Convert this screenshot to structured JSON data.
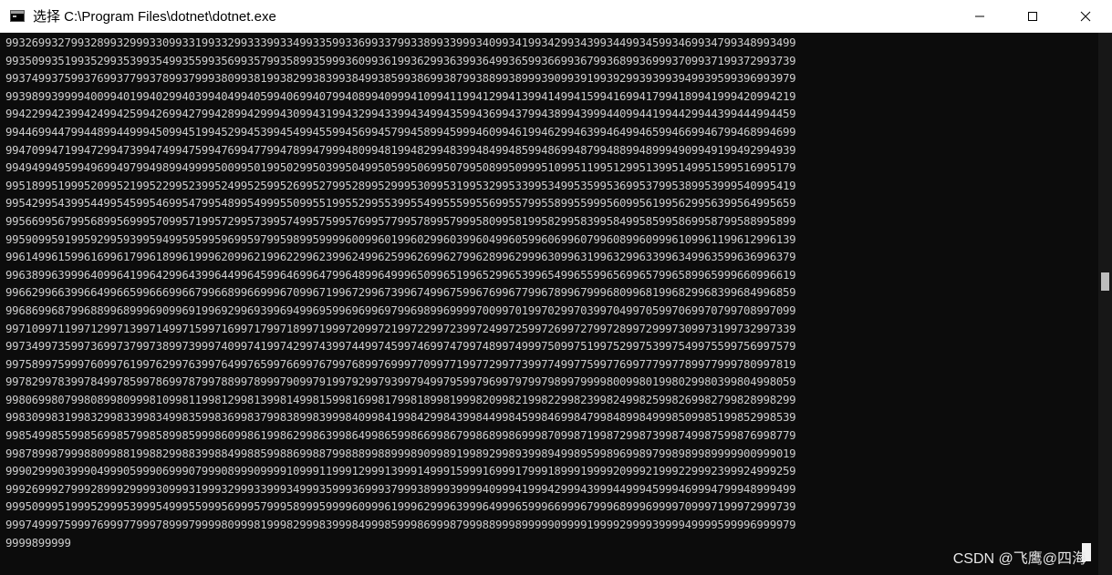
{
  "window": {
    "title": "选择 C:\\Program Files\\dotnet\\dotnet.exe",
    "icon": "console-app-icon",
    "controls": [
      "minimize-icon",
      "maximize-icon",
      "close-icon"
    ]
  },
  "console": {
    "lines": [
      "9932699327993289932999330993319933299333993349933599336993379933899339993409934199342993439934499345993469934799348993499",
      "9935099351993529935399354993559935699357993589935999360993619936299363993649936599366993679936899369993709937199372993739",
      "9937499375993769937799378993799938099381993829938399384993859938699387993889938999390993919939299393993949939599396993979",
      "9939899399994009940199402994039940499405994069940799408994099941099411994129941399414994159941699417994189941999420994219",
      "9942299423994249942599426994279942899429994309943199432994339943499435994369943799438994399944099441994429944399444994459",
      "9944699447994489944999450994519945299453994549945599456994579945899459994609946199462994639946499465994669946799468994699",
      "9947099471994729947399474994759947699477994789947999480994819948299483994849948599486994879948899489994909949199492994939",
      "9949499495994969949799498994999950099501995029950399504995059950699507995089950999510995119951299513995149951599516995179",
      "9951899519995209952199522995239952499525995269952799528995299953099531995329953399534995359953699537995389953999540995419",
      "9954299543995449954599546995479954899549995509955199552995539955499555995569955799558995599956099561995629956399564995659",
      "9956699567995689956999570995719957299573995749957599576995779957899579995809958199582995839958499585995869958799588995899",
      "9959099591995929959399594995959959699597995989959999600996019960299603996049960599606996079960899609996109961199612996139",
      "9961499615996169961799618996199962099621996229962399624996259962699627996289962999630996319963299633996349963599636996379",
      "9963899639996409964199642996439964499645996469964799648996499965099651996529965399654996559965699657996589965999660996619",
      "9966299663996649966599666996679966899669996709967199672996739967499675996769967799678996799968099681996829968399684996859",
      "9968699687996889968999690996919969299693996949969599696996979969899699997009970199702997039970499705997069970799708997099",
      "9971099711997129971399714997159971699717997189971999720997219972299723997249972599726997279972899729997309973199732997339",
      "9973499735997369973799738997399974099741997429974399744997459974699747997489974999750997519975299753997549975599756997579",
      "9975899759997609976199762997639976499765997669976799768997699977099771997729977399774997759977699777997789977999780997819",
      "9978299783997849978599786997879978899789997909979199792997939979499795997969979799798997999980099801998029980399804998059",
      "9980699807998089980999810998119981299813998149981599816998179981899819998209982199822998239982499825998269982799828998299",
      "9983099831998329983399834998359983699837998389983999840998419984299843998449984599846998479984899849998509985199852998539",
      "9985499855998569985799858998599986099861998629986399864998659986699867998689986999870998719987299873998749987599876998779",
      "9987899879998809988199882998839988499885998869988799888998899989099891998929989399894998959989699897998989989999900999019",
      "9990299903999049990599906999079990899909999109991199912999139991499915999169991799918999199992099921999229992399924999259",
      "9992699927999289992999930999319993299933999349993599936999379993899939999409994199942999439994499945999469994799948999499",
      "9995099951999529995399954999559995699957999589995999960999619996299963999649996599966999679996899969999709997199972999739",
      "9997499975999769997799978999799998099981999829998399984999859998699987999889998999990999919999299993999949999599996999979",
      "9999899999"
    ]
  },
  "watermark": "CSDN @飞鹰@四海",
  "colors": {
    "console_bg": "#0c0c0c",
    "console_text": "#cccccc",
    "titlebar_bg": "#ffffff"
  }
}
